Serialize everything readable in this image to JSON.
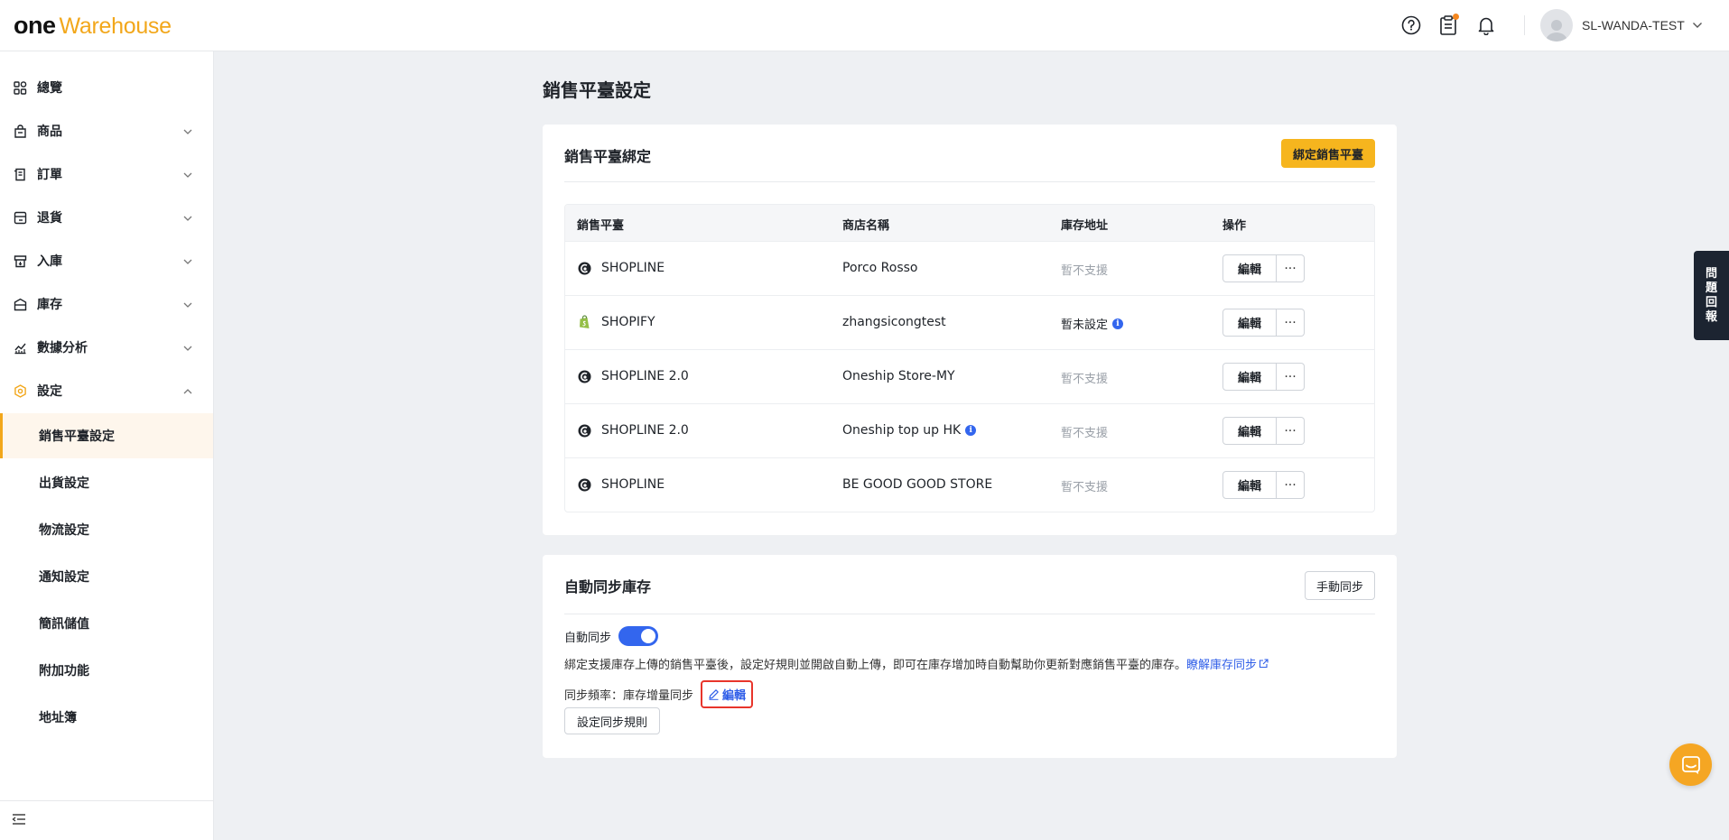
{
  "app": {
    "logo_one": "one",
    "logo_warehouse": "Warehouse",
    "user_name": "SL-WANDA-TEST"
  },
  "sidebar": {
    "items": [
      {
        "label": "總覽",
        "icon": "dashboard-icon"
      },
      {
        "label": "商品",
        "icon": "product-icon"
      },
      {
        "label": "訂單",
        "icon": "order-icon"
      },
      {
        "label": "退貨",
        "icon": "return-icon"
      },
      {
        "label": "入庫",
        "icon": "inbound-icon"
      },
      {
        "label": "庫存",
        "icon": "inventory-icon"
      },
      {
        "label": "數據分析",
        "icon": "analytics-icon"
      },
      {
        "label": "設定",
        "icon": "settings-icon",
        "expanded": true
      }
    ],
    "sub_items": [
      {
        "label": "銷售平臺設定",
        "active": true
      },
      {
        "label": "出貨設定"
      },
      {
        "label": "物流設定"
      },
      {
        "label": "通知設定"
      },
      {
        "label": "簡訊儲值"
      },
      {
        "label": "附加功能"
      },
      {
        "label": "地址簿"
      }
    ]
  },
  "page": {
    "title": "銷售平臺設定"
  },
  "binding": {
    "title": "銷售平臺綁定",
    "bind_button": "綁定銷售平臺",
    "columns": [
      "銷售平臺",
      "商店名稱",
      "庫存地址",
      "操作"
    ],
    "rows": [
      {
        "platform": "SHOPLINE",
        "platform_icon": "shopline-icon",
        "store": "Porco Rosso",
        "address": "暫不支援",
        "address_muted": true,
        "edit": "編輯"
      },
      {
        "platform": "SHOPIFY",
        "platform_icon": "shopify-icon",
        "store": "zhangsicongtest",
        "address": "暫未設定",
        "address_muted": false,
        "address_info": true,
        "edit": "編輯"
      },
      {
        "platform": "SHOPLINE 2.0",
        "platform_icon": "shopline-icon",
        "store": "Oneship Store-MY",
        "address": "暫不支援",
        "address_muted": true,
        "edit": "編輯"
      },
      {
        "platform": "SHOPLINE 2.0",
        "platform_icon": "shopline-icon",
        "store": "Oneship top up HK",
        "store_info": true,
        "address": "暫不支援",
        "address_muted": true,
        "edit": "編輯"
      },
      {
        "platform": "SHOPLINE",
        "platform_icon": "shopline-icon",
        "store": "BE GOOD GOOD STORE",
        "address": "暫不支援",
        "address_muted": true,
        "edit": "編輯"
      }
    ]
  },
  "auto_sync": {
    "title": "自動同步庫存",
    "manual_button": "手動同步",
    "toggle_label": "自動同步",
    "toggle_on": true,
    "description": "綁定支援庫存上傳的銷售平臺後，設定好規則並開啟自動上傳，即可在庫存增加時自動幫助你更新對應銷售平臺的庫存。",
    "learn_link": "瞭解庫存同步",
    "freq_label": "同步頻率：",
    "freq_value": "庫存增量同步",
    "freq_edit": "編輯",
    "rules_button": "設定同步規則"
  },
  "feedback_tab": [
    "問",
    "題",
    "回",
    "報"
  ],
  "colors": {
    "accent": "#f6b51e",
    "brand_orange": "#f2a71b",
    "link_blue": "#2f5ee8",
    "highlight_red": "#e8352b"
  }
}
